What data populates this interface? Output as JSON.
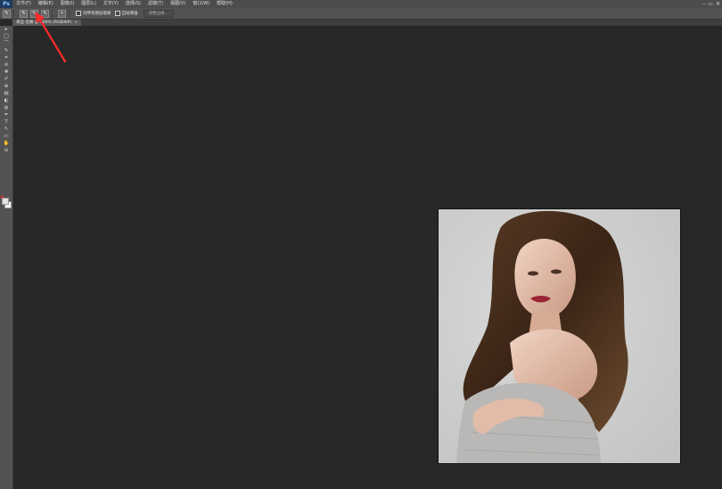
{
  "app": {
    "logo": "Ps"
  },
  "menu": {
    "items": [
      "文件(F)",
      "编辑(E)",
      "图像(I)",
      "图层(L)",
      "文字(Y)",
      "选择(S)",
      "滤镜(T)",
      "视图(V)",
      "窗口(W)",
      "帮助(H)"
    ]
  },
  "window_controls": {
    "minimize": "–",
    "restore": "▭",
    "close": "✕"
  },
  "options_bar": {
    "tool_icon": "brush-icon",
    "mode_icons": [
      "new-selection-icon",
      "add-to-selection-icon",
      "subtract-selection-icon"
    ],
    "sample_all_layers_label": "对所有图层取样",
    "auto_enhance_label": "自动增强",
    "refine_edge_label": "调整边缘..."
  },
  "document": {
    "tab_label": "来自 云端 @ 100% (RGB/8#)",
    "close_label": "×"
  },
  "toolbar": {
    "tools": [
      "▸",
      "◯",
      "⌒",
      "✎",
      "⌗",
      "⊘",
      "✚",
      "✐",
      "⊕",
      "▤",
      "◐",
      "◍",
      "✒",
      "T",
      "↖",
      "▭",
      "✋",
      "⊖"
    ]
  },
  "colors": {
    "accent_arrow": "#ff2a2a",
    "foreground": "#e8e2df",
    "background": "#ffffff"
  }
}
